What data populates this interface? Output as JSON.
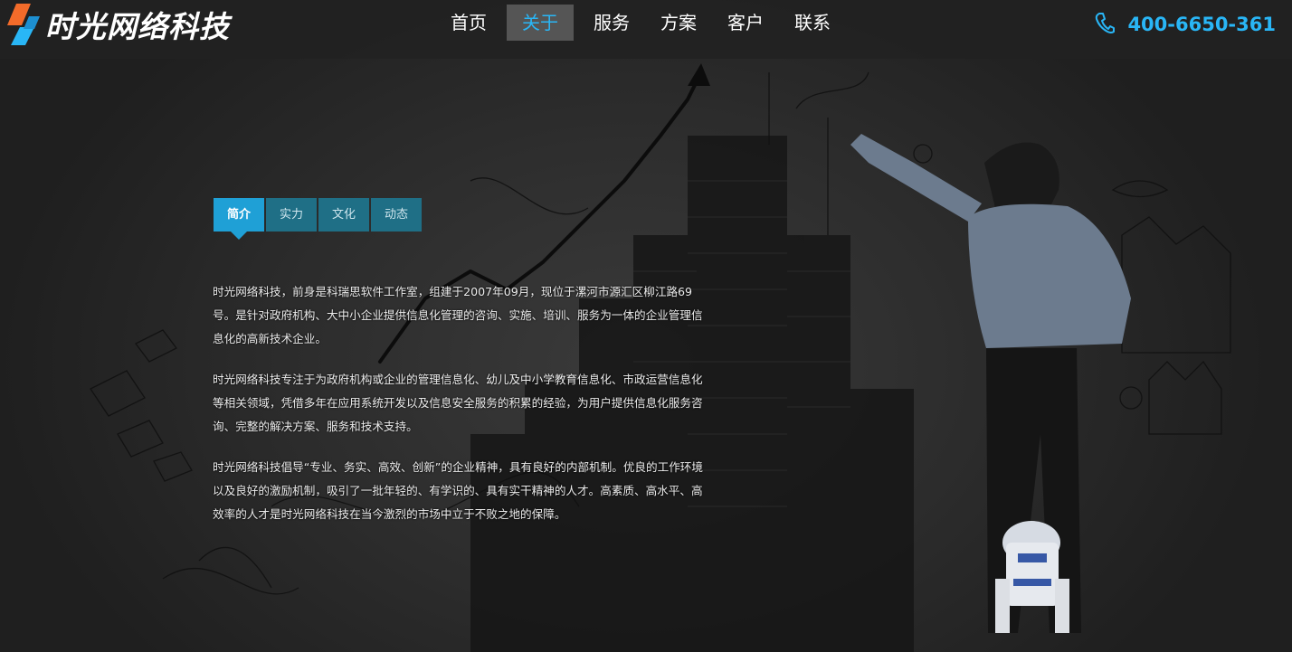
{
  "brand": {
    "name": "时光网络科技",
    "accent_blue": "#29b6f6",
    "accent_orange": "#f26b2a"
  },
  "nav": {
    "items": [
      {
        "label": "首页",
        "active": false
      },
      {
        "label": "关于",
        "active": true
      },
      {
        "label": "服务",
        "active": false
      },
      {
        "label": "方案",
        "active": false
      },
      {
        "label": "客户",
        "active": false
      },
      {
        "label": "联系",
        "active": false
      }
    ]
  },
  "phone": {
    "icon": "phone-icon",
    "number": "400-6650-361"
  },
  "tabs": [
    {
      "label": "简介",
      "active": true
    },
    {
      "label": "实力",
      "active": false
    },
    {
      "label": "文化",
      "active": false
    },
    {
      "label": "动态",
      "active": false
    }
  ],
  "about": {
    "paragraphs": [
      "时光网络科技，前身是科瑞思软件工作室，组建于2007年09月，现位于漯河市源汇区柳江路69号。是针对政府机构、大中小企业提供信息化管理的咨询、实施、培训、服务为一体的企业管理信息化的高新技术企业。",
      "时光网络科技专注于为政府机构或企业的管理信息化、幼儿及中小学教育信息化、市政运营信息化等相关领域，凭借多年在应用系统开发以及信息安全服务的积累的经验，为用户提供信息化服务咨询、完整的解决方案、服务和技术支持。",
      "时光网络科技倡导“专业、务实、高效、创新”的企业精神，具有良好的内部机制。优良的工作环境以及良好的激励机制，吸引了一批年轻的、有学识的、具有实干精神的人才。高素质、高水平、高效率的人才是时光网络科技在当今激烈的市场中立于不败之地的保障。"
    ]
  }
}
